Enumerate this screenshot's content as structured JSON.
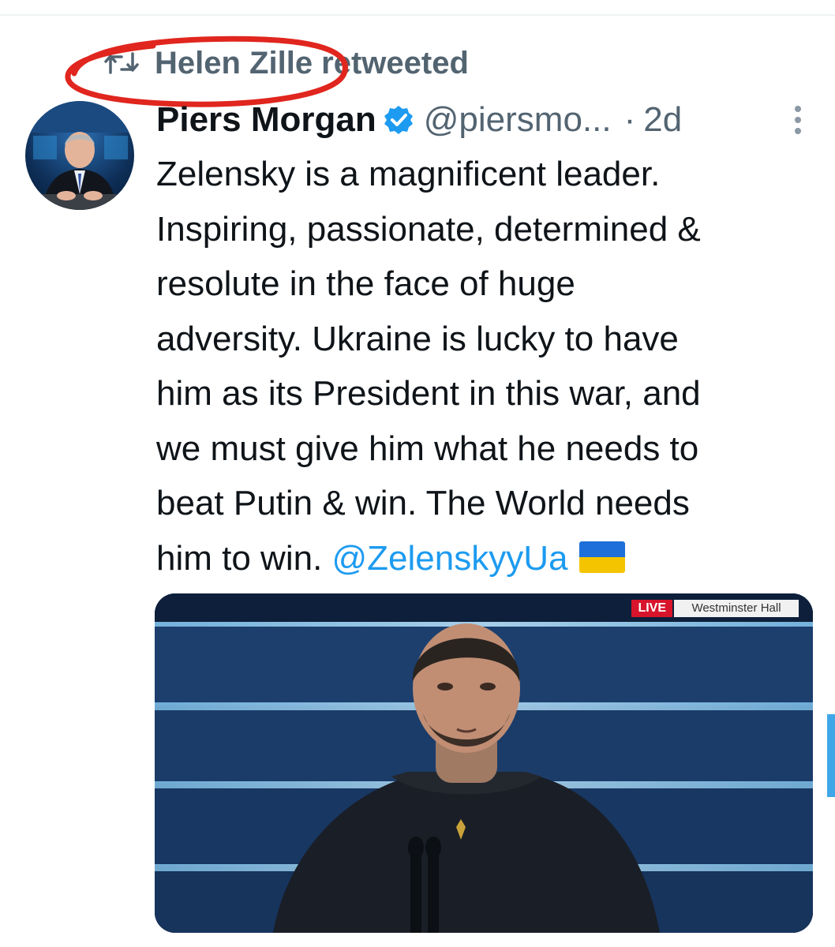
{
  "retweet": {
    "label": "Helen Zille retweeted",
    "icon": "retweet-icon"
  },
  "tweet": {
    "author": {
      "display_name": "Piers Morgan",
      "handle": "@piersmo...",
      "verified": true
    },
    "time_separator": "·",
    "time": "2d",
    "text_lines": [
      "Zelensky is a magnificent leader.",
      "Inspiring, passionate, determined &",
      "resolute in the face of huge",
      "adversity. Ukraine is lucky to have",
      "him as its President in this war, and",
      "we must give him what he needs to",
      "beat Putin & win. The World needs"
    ],
    "last_line_prefix": "him to win. ",
    "mention": "@ZelenskyyUa",
    "emoji": "ukraine-flag"
  },
  "media": {
    "live_label": "LIVE",
    "location_label": "Westminster Hall"
  },
  "colors": {
    "link": "#1d9bf0",
    "secondary_text": "#536471",
    "annotation_red": "#e0261e",
    "live_red": "#d7142b"
  }
}
